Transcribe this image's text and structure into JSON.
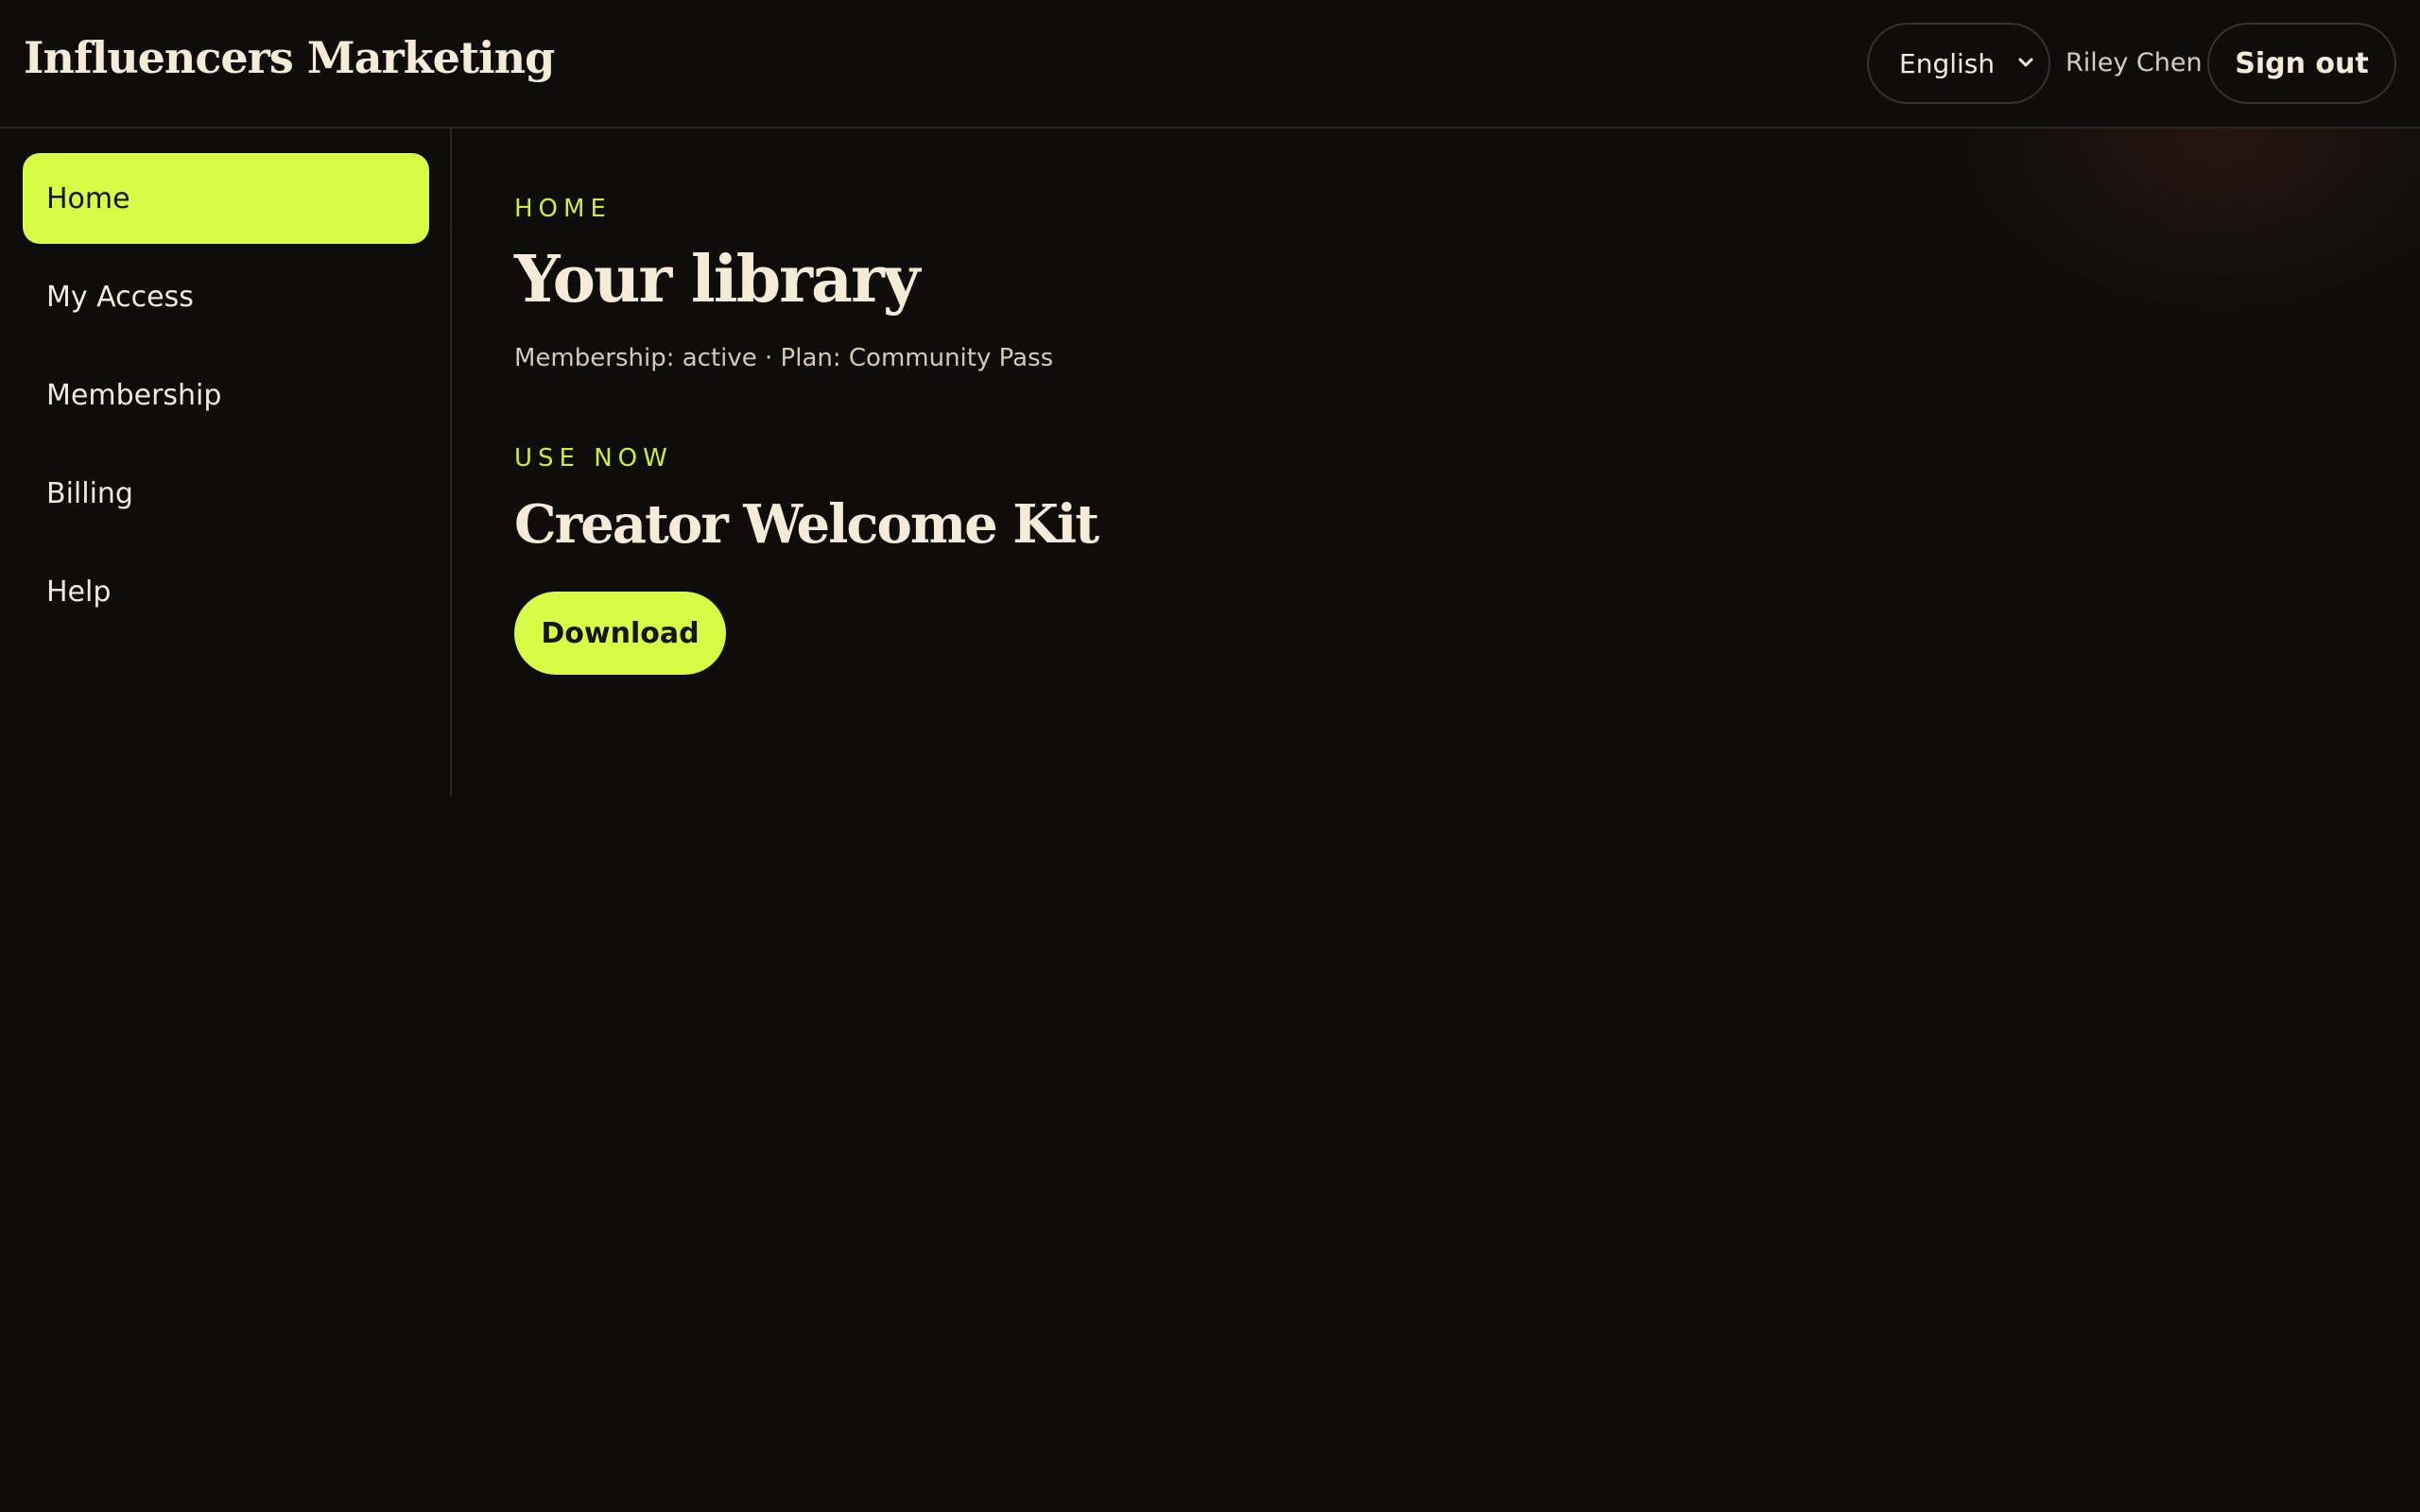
{
  "app": {
    "brand": "Influencers Marketing",
    "accent_color": "#d8fc45",
    "background_color": "#0e0d0c"
  },
  "header": {
    "language": {
      "selected": "English"
    },
    "user_name": "Riley Chen",
    "sign_out_label": "Sign out"
  },
  "sidebar": {
    "items": [
      {
        "label": "Home",
        "active": true
      },
      {
        "label": "My Access",
        "active": false
      },
      {
        "label": "Membership",
        "active": false
      },
      {
        "label": "Billing",
        "active": false
      },
      {
        "label": "Help",
        "active": false
      }
    ]
  },
  "main": {
    "eyebrow": "HOME",
    "title": "Your library",
    "status": "Membership: active · Plan: Community Pass",
    "section": {
      "eyebrow": "USE NOW",
      "item_title": "Creator Welcome Kit",
      "download_label": "Download"
    }
  }
}
